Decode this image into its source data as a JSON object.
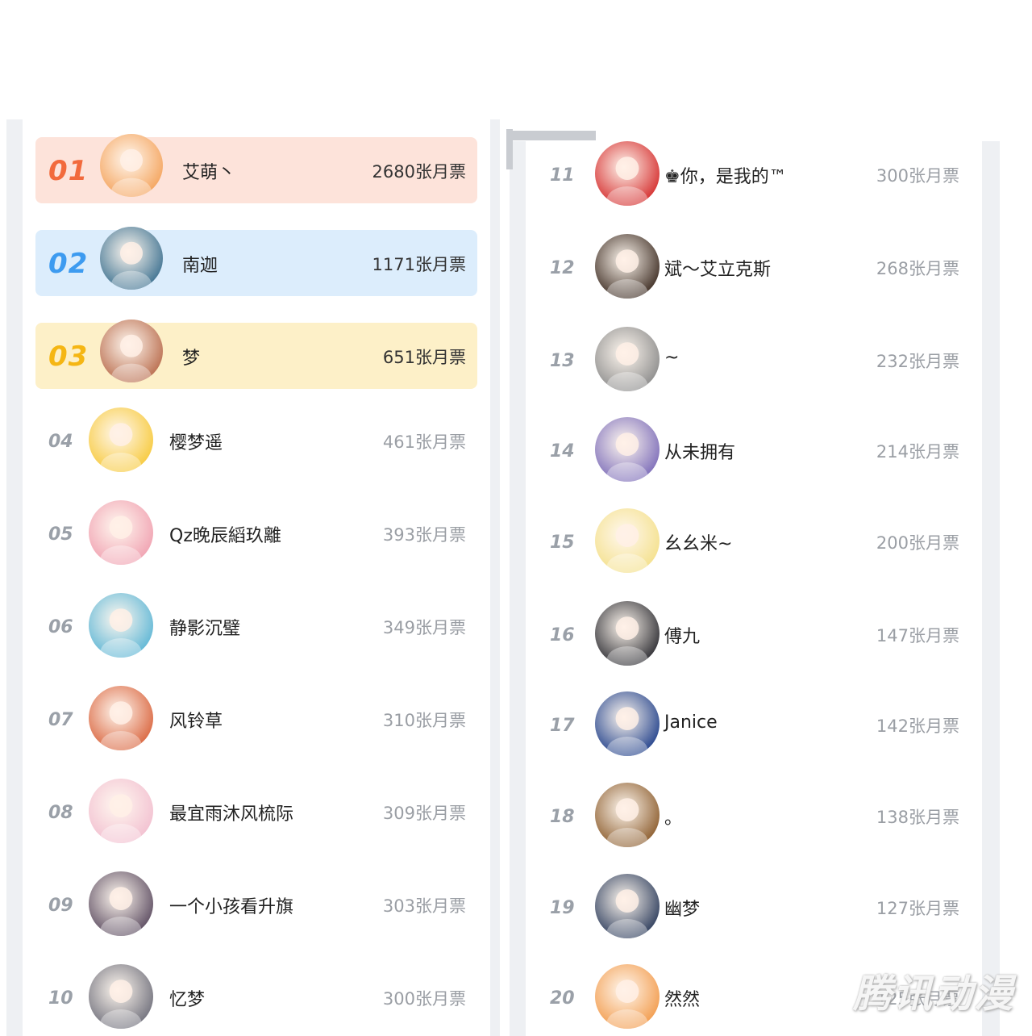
{
  "left_list": [
    {
      "rank": "01",
      "name": "艾萌丶",
      "votes": "2680张月票",
      "avatar_color": "#f4a25a"
    },
    {
      "rank": "02",
      "name": "南迦",
      "votes": "1171张月票",
      "avatar_color": "#3a6f8f"
    },
    {
      "rank": "03",
      "name": "梦",
      "votes": "651张月票",
      "avatar_color": "#b86a4a"
    },
    {
      "rank": "04",
      "name": "樱梦遥",
      "votes": "461张月票",
      "avatar_color": "#f7c93a"
    },
    {
      "rank": "05",
      "name": "Qz晚辰縚玖離",
      "votes": "393张月票",
      "avatar_color": "#f0a0b0"
    },
    {
      "rank": "06",
      "name": "静影沉璧",
      "votes": "349张月票",
      "avatar_color": "#5bb5d5"
    },
    {
      "rank": "07",
      "name": "风铃草",
      "votes": "310张月票",
      "avatar_color": "#d9633c"
    },
    {
      "rank": "08",
      "name": "最宜雨沐风梳际",
      "votes": "309张月票",
      "avatar_color": "#f2bfd0"
    },
    {
      "rank": "09",
      "name": "一个小孩看升旗",
      "votes": "303张月票",
      "avatar_color": "#5a4a5f"
    },
    {
      "rank": "10",
      "name": "忆梦",
      "votes": "300张月票",
      "avatar_color": "#6e6e7a"
    }
  ],
  "right_list": [
    {
      "rank": "11",
      "name": "♚你，是我的™",
      "votes": "300张月票",
      "avatar_color": "#d42a2a"
    },
    {
      "rank": "12",
      "name": "斌～艾立克斯",
      "votes": "268张月票",
      "avatar_color": "#3b2a20"
    },
    {
      "rank": "13",
      "name": "~",
      "votes": "232张月票",
      "avatar_color": "#8a8a8a"
    },
    {
      "rank": "14",
      "name": "从未拥有",
      "votes": "214张月票",
      "avatar_color": "#7a6ab8"
    },
    {
      "rank": "15",
      "name": "幺幺米~",
      "votes": "200张月票",
      "avatar_color": "#f4e08a"
    },
    {
      "rank": "16",
      "name": "傅九",
      "votes": "147张月票",
      "avatar_color": "#2a2a30"
    },
    {
      "rank": "17",
      "name": "Janice",
      "votes": "142张月票",
      "avatar_color": "#1f3f8a"
    },
    {
      "rank": "18",
      "name": "。",
      "votes": "138张月票",
      "avatar_color": "#8a5a2a"
    },
    {
      "rank": "19",
      "name": "幽梦",
      "votes": "127张月票",
      "avatar_color": "#2a3a5a"
    },
    {
      "rank": "20",
      "name": "然然",
      "votes": "125张月票",
      "avatar_color": "#f29a4a"
    }
  ],
  "watermark": "腾讯动漫"
}
